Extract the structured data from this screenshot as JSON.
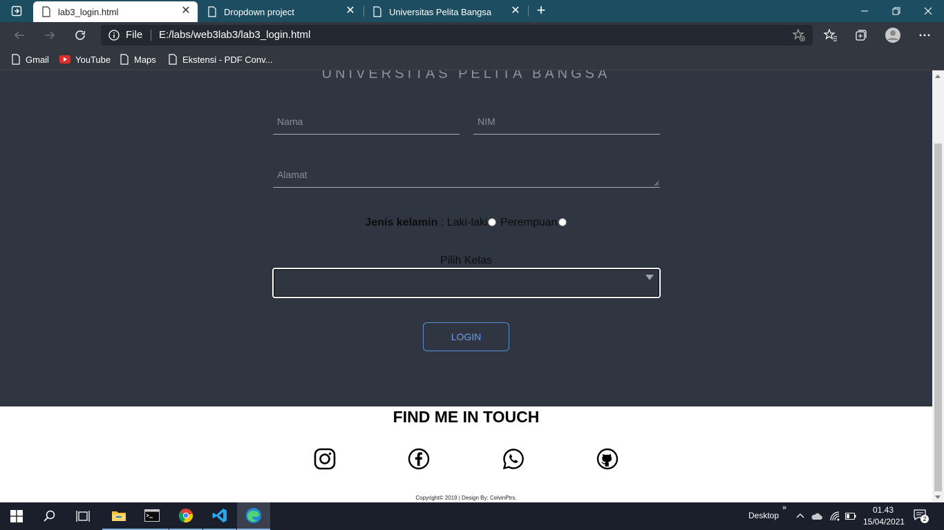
{
  "browser": {
    "tabs": [
      {
        "title": "lab3_login.html",
        "active": true
      },
      {
        "title": "Dropdown project",
        "active": false
      },
      {
        "title": "Universitas Pelita Bangsa",
        "active": false
      }
    ],
    "address": {
      "scheme_label": "File",
      "url": "E:/labs/web3lab3/lab3_login.html"
    },
    "bookmarks": [
      {
        "label": "Gmail",
        "icon": "page-icon"
      },
      {
        "label": "YouTube",
        "icon": "youtube-icon"
      },
      {
        "label": "Maps",
        "icon": "page-icon"
      },
      {
        "label": "Ekstensi - PDF Conv...",
        "icon": "page-icon"
      }
    ]
  },
  "page": {
    "heading": "UNIVERSITAS PELITA BANGSA",
    "form": {
      "nama_placeholder": "Nama",
      "nim_placeholder": "NIM",
      "alamat_placeholder": "Alamat",
      "gender_label": "Jenis kelamin",
      "gender_separator": " : ",
      "gender_options": [
        "Laki-laki",
        "Perempuan"
      ],
      "select_label": "Pilih Kelas",
      "select_value": "",
      "login_label": "LOGIN"
    },
    "footer": {
      "title": "FIND ME IN TOUCH",
      "socials": [
        "instagram-icon",
        "facebook-icon",
        "whatsapp-icon",
        "github-icon"
      ],
      "copyright": "Copyright© 2019 | Design By: CelvinPtrs."
    }
  },
  "taskbar": {
    "desktop_label": "Desktop",
    "time": "01.43",
    "date": "15/04/2021",
    "notification_count": "2"
  },
  "colors": {
    "tabbar": "#1d4d61",
    "chrome": "#333740",
    "form_bg": "#2f3541",
    "accent_button": "#6f9ee8",
    "taskbar": "#1a1f2b"
  }
}
